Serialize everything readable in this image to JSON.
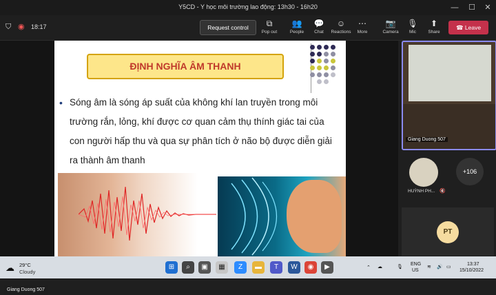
{
  "titlebar": {
    "title": "Y5CD - Y học môi trường lao động: 13h30 - 16h20",
    "minimize": "—",
    "maximize": "☐",
    "close": "✕"
  },
  "toolbar": {
    "timer": "18:17",
    "request_control": "Request control",
    "buttons": [
      {
        "label": "Pop out",
        "icon": "⧉"
      },
      {
        "label": "People",
        "icon": "👥"
      },
      {
        "label": "Chat",
        "icon": "💬"
      },
      {
        "label": "Reactions",
        "icon": "☺"
      },
      {
        "label": "More",
        "icon": "⋯"
      },
      {
        "label": "Camera",
        "icon": "📷"
      },
      {
        "label": "Mic",
        "icon": "🎙"
      },
      {
        "label": "Share",
        "icon": "⬆"
      }
    ],
    "leave": "Leave"
  },
  "slide": {
    "title": "ĐỊNH NGHĨA ÂM THANH",
    "bullet": "•",
    "body": "Sóng âm là sóng áp suất của không khí lan truyền trong môi trường rắn, lỏng, khí được cơ quan cảm thụ thính giác tai của con người hấp thu và qua sự phân tích ở não bộ được diễn giải ra thành âm thanh"
  },
  "presenter_tag": "Giang Duong 507",
  "participants": {
    "video_name": "Giang Duong 507",
    "avatar_name": "HUỲNH PH...",
    "more_count": "+106",
    "initials": "PT"
  },
  "taskbar": {
    "temperature": "29°C",
    "condition": "Cloudy",
    "language_top": "ENG",
    "language_bottom": "US",
    "time": "13:37",
    "date": "15/10/2022"
  }
}
